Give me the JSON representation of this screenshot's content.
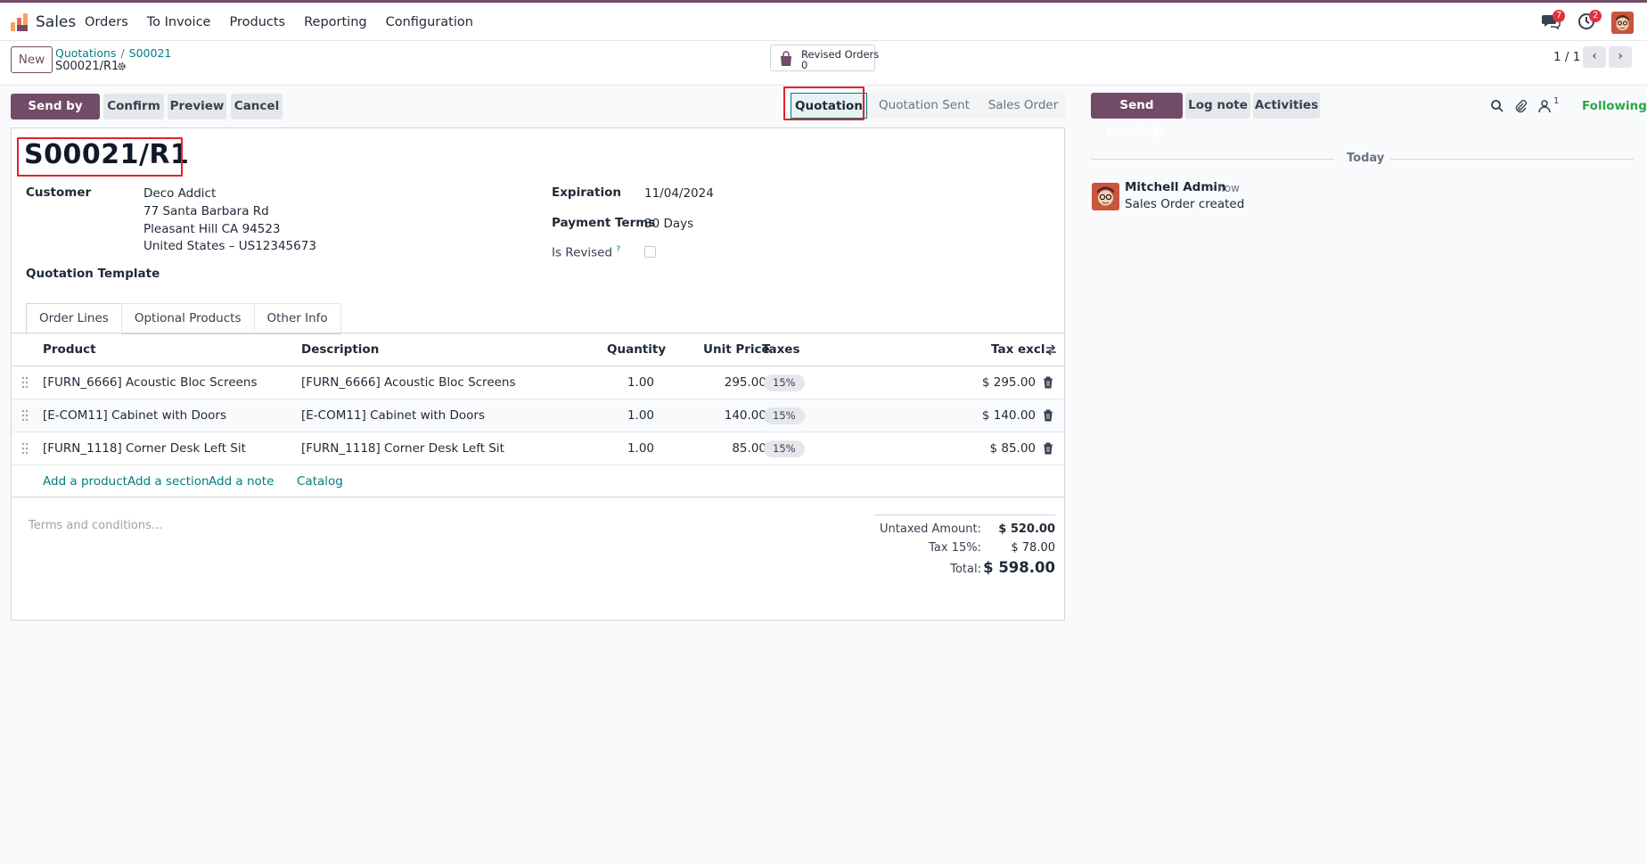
{
  "app": {
    "name": "Sales"
  },
  "menu": [
    "Orders",
    "To Invoice",
    "Products",
    "Reporting",
    "Configuration"
  ],
  "systray": {
    "messages_badge": "7",
    "activities_badge": "2"
  },
  "control_panel": {
    "new_label": "New",
    "breadcrumb_parent": "Quotations",
    "breadcrumb_sep": "/",
    "breadcrumb_record": "S00021",
    "current_record": "S00021/R1",
    "smart_button": {
      "label": "Revised Orders",
      "count": "0"
    },
    "pager": "1 / 1"
  },
  "actions": {
    "send_email": "Send by Email",
    "confirm": "Confirm",
    "preview": "Preview",
    "cancel": "Cancel"
  },
  "statusbar": {
    "quotation": "Quotation",
    "sent": "Quotation Sent",
    "sale": "Sales Order"
  },
  "form": {
    "title": "S00021/R1",
    "customer_label": "Customer",
    "customer_name": "Deco Addict",
    "customer_addr1": "77 Santa Barbara Rd",
    "customer_addr2": "Pleasant Hill CA 94523",
    "customer_addr3": "United States – US12345673",
    "template_label": "Quotation Template",
    "expiration_label": "Expiration",
    "expiration_value": "11/04/2024",
    "terms_label": "Payment Terms",
    "terms_value": "30 Days",
    "revised_label": "Is Revised",
    "revised_help": "?"
  },
  "tabs": [
    "Order Lines",
    "Optional Products",
    "Other Info"
  ],
  "table": {
    "headers": {
      "product": "Product",
      "description": "Description",
      "quantity": "Quantity",
      "unit_price": "Unit Price",
      "taxes": "Taxes",
      "subtotal": "Tax excl."
    },
    "rows": [
      {
        "product": "[FURN_6666] Acoustic Bloc Screens",
        "description": "[FURN_6666] Acoustic Bloc Screens",
        "quantity": "1.00",
        "unit_price": "295.00",
        "tax": "15%",
        "subtotal": "$ 295.00"
      },
      {
        "product": "[E-COM11] Cabinet with Doors",
        "description": "[E-COM11] Cabinet with Doors",
        "quantity": "1.00",
        "unit_price": "140.00",
        "tax": "15%",
        "subtotal": "$ 140.00"
      },
      {
        "product": "[FURN_1118] Corner Desk Left Sit",
        "description": "[FURN_1118] Corner Desk Left Sit",
        "quantity": "1.00",
        "unit_price": "85.00",
        "tax": "15%",
        "subtotal": "$ 85.00"
      }
    ],
    "add_product": "Add a product",
    "add_section": "Add a section",
    "add_note": "Add a note",
    "catalog": "Catalog"
  },
  "terms_placeholder": "Terms and conditions...",
  "totals": {
    "untaxed_label": "Untaxed Amount:",
    "untaxed_value": "$ 520.00",
    "tax_label": "Tax 15%:",
    "tax_value": "$ 78.00",
    "total_label": "Total:",
    "total_value": "$ 598.00"
  },
  "chatter": {
    "send_message": "Send message",
    "log_note": "Log note",
    "activities": "Activities",
    "followers_count": "1",
    "following": "Following",
    "today": "Today",
    "author": "Mitchell Admin",
    "time": "- now",
    "body": "Sales Order created"
  },
  "colors": {
    "brand": "#714b67",
    "link": "#017e84",
    "highlight": "#e3222a",
    "following": "#28a745"
  }
}
